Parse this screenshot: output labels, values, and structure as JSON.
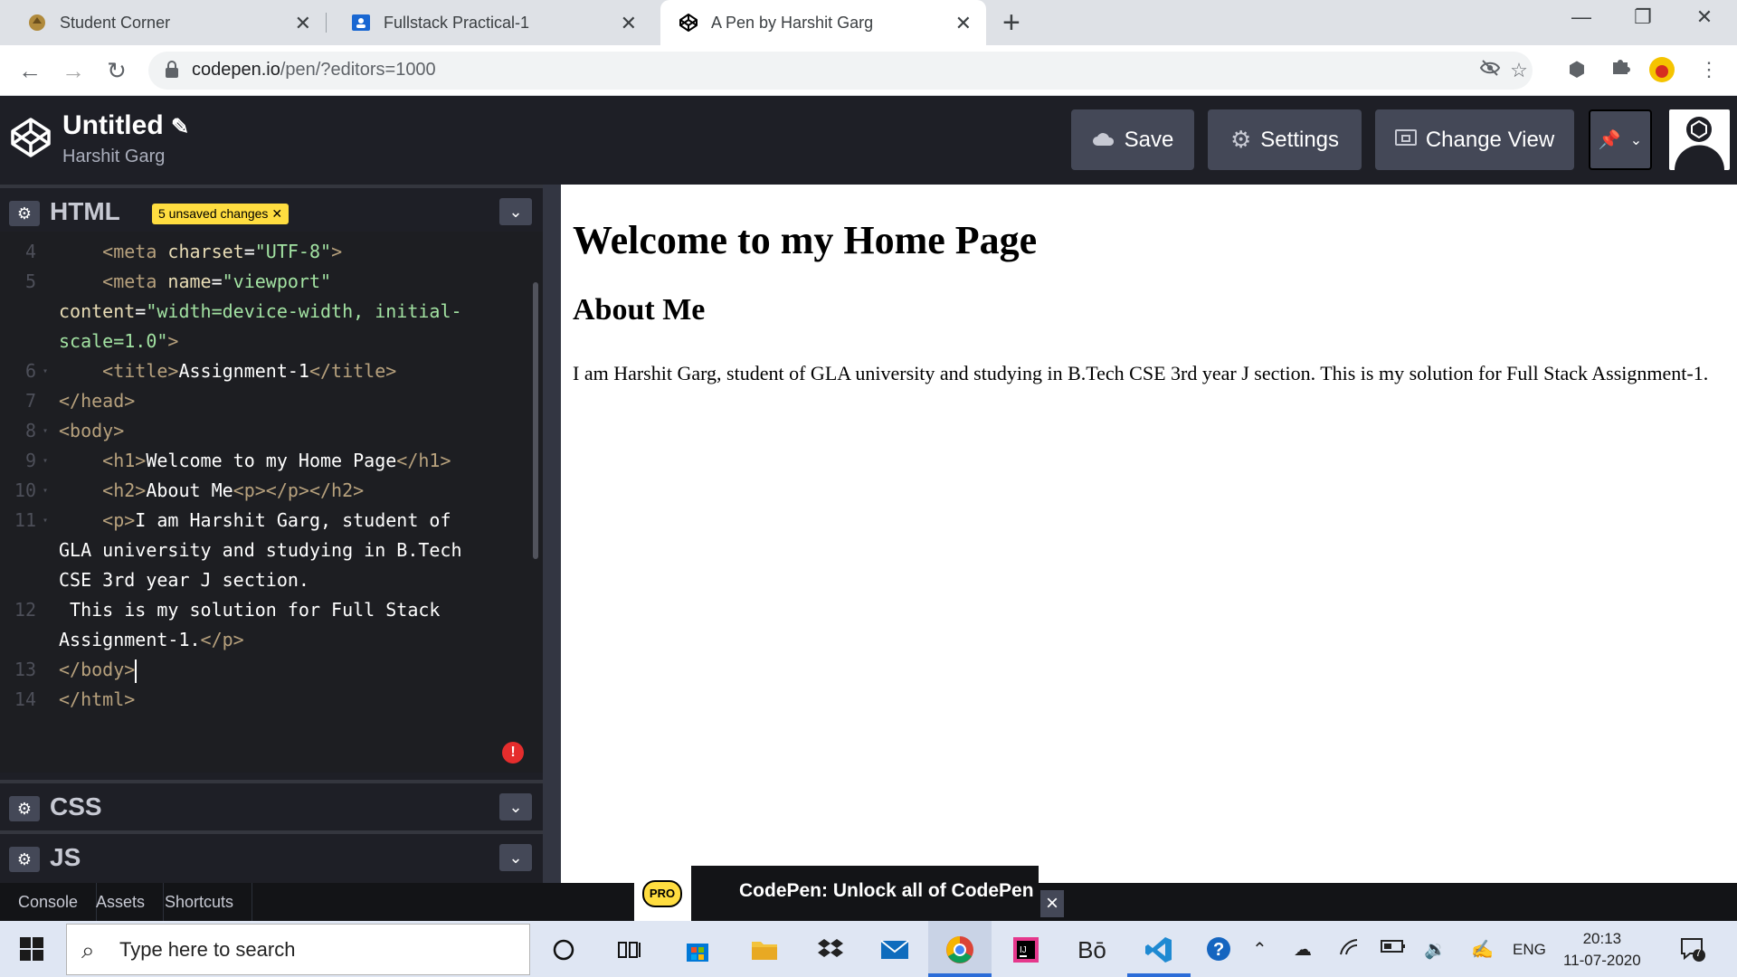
{
  "browser": {
    "tabs": [
      {
        "title": "Student Corner",
        "active": false
      },
      {
        "title": "Fullstack Practical-1",
        "active": false
      },
      {
        "title": "A Pen by Harshit Garg",
        "active": true
      }
    ],
    "url_host": "codepen.io",
    "url_path": "/pen/?editors=1000"
  },
  "codepen": {
    "title": "Untitled",
    "author": "Harshit Garg",
    "buttons": {
      "save": "Save",
      "settings": "Settings",
      "change_view": "Change View"
    },
    "html_pane": {
      "title": "HTML",
      "badge": "5 unsaved changes"
    },
    "css_pane": {
      "title": "CSS"
    },
    "js_pane": {
      "title": "JS"
    },
    "code_lines": [
      {
        "n": "4",
        "text": "    <meta charset=\"UTF-8\">"
      },
      {
        "n": "5",
        "text": "    <meta name=\"viewport\""
      },
      {
        "n": "",
        "text": "content=\"width=device-width, initial-"
      },
      {
        "n": "",
        "text": "scale=1.0\">"
      },
      {
        "n": "6",
        "text": "    <title>Assignment-1</title>"
      },
      {
        "n": "7",
        "text": "</head>"
      },
      {
        "n": "8",
        "text": "<body>"
      },
      {
        "n": "9",
        "text": "    <h1>Welcome to my Home Page</h1>"
      },
      {
        "n": "10",
        "text": "    <h2>About Me<p></p></h2>"
      },
      {
        "n": "11",
        "text": "    <p>I am Harshit Garg, student of"
      },
      {
        "n": "",
        "text": "GLA university and studying in B.Tech"
      },
      {
        "n": "",
        "text": "CSE 3rd year J section."
      },
      {
        "n": "12",
        "text": " This is my solution for Full Stack"
      },
      {
        "n": "",
        "text": "Assignment-1.</p>"
      },
      {
        "n": "13",
        "text": "</body>"
      },
      {
        "n": "14",
        "text": "</html>"
      }
    ],
    "footer": {
      "console": "Console",
      "assets": "Assets",
      "shortcuts": "Shortcuts"
    },
    "toast": {
      "badge": "PRO",
      "text": "CodePen: Unlock all of CodePen"
    }
  },
  "preview": {
    "h1": "Welcome to my Home Page",
    "h2": "About Me",
    "p": "I am Harshit Garg, student of GLA university and studying in B.Tech CSE 3rd year J section. This is my solution for Full Stack Assignment-1."
  },
  "taskbar": {
    "search_placeholder": "Type here to search",
    "language": "ENG",
    "time": "20:13",
    "date": "11-07-2020",
    "notifications": "7"
  }
}
